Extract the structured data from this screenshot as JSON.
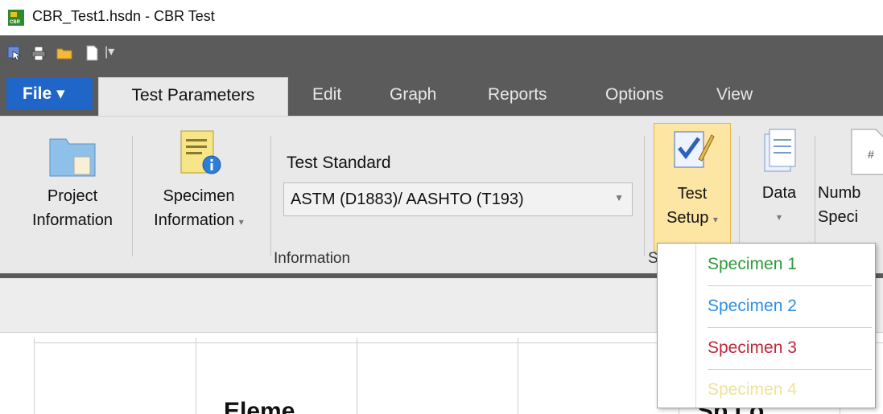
{
  "window": {
    "title": "CBR_Test1.hsdn - CBR Test"
  },
  "tabs": {
    "file": "File",
    "items": [
      "Test Parameters",
      "Edit",
      "Graph",
      "Reports",
      "Options",
      "View"
    ],
    "active": "Test Parameters"
  },
  "ribbon": {
    "project_info": [
      "Project",
      "Information"
    ],
    "specimen_info": [
      "Specimen",
      "Information"
    ],
    "test_standard_label": "Test Standard",
    "test_standard_value": "ASTM (D1883)/ AASHTO (T193)",
    "group_information": "Information",
    "test_setup": [
      "Test",
      "Setup"
    ],
    "data": "Data",
    "number_partial": [
      "Numb",
      "Speci"
    ],
    "group_s": "S"
  },
  "dropdown": {
    "items": [
      {
        "label": "Specimen 1",
        "color": "#2e9a3a"
      },
      {
        "label": "Specimen 2",
        "color": "#2f8ee6"
      },
      {
        "label": "Specimen 3",
        "color": "#c2263a"
      },
      {
        "label": "Specimen 4",
        "color": "#ede39a"
      }
    ]
  },
  "lower": {
    "text1": "Eleme",
    "text2": "Sp   Lo"
  },
  "colors": {
    "file_tab": "#1f66c8",
    "toolbar": "#5b5b5b",
    "ribbon": "#e9e9e9",
    "test_setup_highlight": "#fde6a4"
  },
  "icons": [
    "app-icon",
    "select-icon",
    "print-icon",
    "folder-icon",
    "document-icon",
    "qat-customize-icon",
    "project-folder-icon",
    "specimen-info-icon",
    "test-setup-icon",
    "data-icon",
    "number-specimens-icon"
  ]
}
